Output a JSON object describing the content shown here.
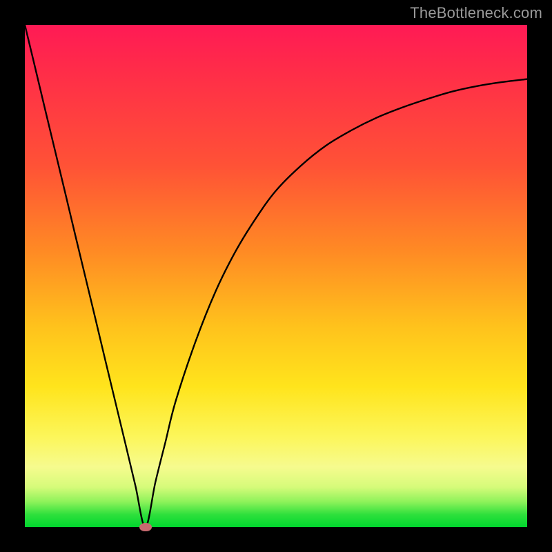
{
  "watermark": "TheBottleneck.com",
  "colors": {
    "frame": "#000000",
    "curve_stroke": "#000000",
    "marker_fill": "#c76a70",
    "gradient_top": "#ff1a55",
    "gradient_bottom": "#00d62e",
    "watermark_text": "#9a9a9a"
  },
  "chart_data": {
    "type": "line",
    "title": "",
    "xlabel": "",
    "ylabel": "",
    "xlim": [
      0,
      100
    ],
    "ylim": [
      0,
      100
    ],
    "grid": false,
    "legend": false,
    "annotations": [],
    "marker": {
      "x": 24,
      "y": 0
    },
    "x": [
      0,
      2,
      4,
      6,
      8,
      10,
      12,
      14,
      16,
      18,
      20,
      22,
      24,
      26,
      28,
      30,
      34,
      38,
      42,
      46,
      50,
      55,
      60,
      65,
      70,
      75,
      80,
      85,
      90,
      95,
      100
    ],
    "y": [
      100,
      91.7,
      83.3,
      75.0,
      66.7,
      58.3,
      50.0,
      41.7,
      33.3,
      25.0,
      16.7,
      8.3,
      0.0,
      9.0,
      17.0,
      25.0,
      37.0,
      47.0,
      55.0,
      61.5,
      67.0,
      72.0,
      76.0,
      79.0,
      81.5,
      83.5,
      85.2,
      86.7,
      87.8,
      88.6,
      89.2
    ]
  }
}
